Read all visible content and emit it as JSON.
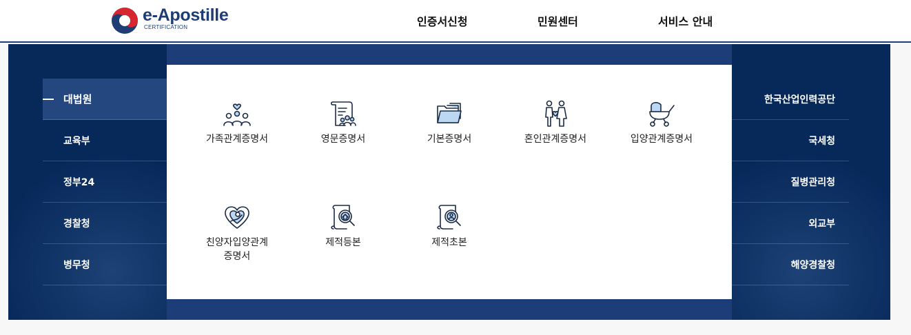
{
  "header": {
    "logo_title": "e-Apostille",
    "logo_sub": "CERTIFICATION",
    "nav": [
      "인증서신청",
      "민원센터",
      "서비스 안내"
    ]
  },
  "left_menu": {
    "items": [
      "대법원",
      "교육부",
      "정부24",
      "경찰청",
      "병무청"
    ],
    "active": "대법원"
  },
  "right_menu": {
    "items": [
      "한국산업인력공단",
      "국세청",
      "질병관리청",
      "외교부",
      "해양경찰청"
    ]
  },
  "documents": [
    {
      "label": "가족관계증명서",
      "icon": "family-icon"
    },
    {
      "label": "영문증명서",
      "icon": "english-document-icon"
    },
    {
      "label": "기본증명서",
      "icon": "folder-icon"
    },
    {
      "label": "혼인관계증명서",
      "icon": "couple-icon"
    },
    {
      "label": "입양관계증명서",
      "icon": "baby-stroller-icon"
    },
    {
      "label": "친양자입양관계\n증명서",
      "icon": "heart-hands-icon"
    },
    {
      "label": "제적등본",
      "icon": "house-search-icon"
    },
    {
      "label": "제적초본",
      "icon": "person-search-icon"
    }
  ],
  "colors": {
    "primary": "#1d3d74",
    "background": "#07295a",
    "panel_band": "#1d3d78",
    "active_item": "#24477f",
    "icon_fill": "#bcd7f2"
  }
}
